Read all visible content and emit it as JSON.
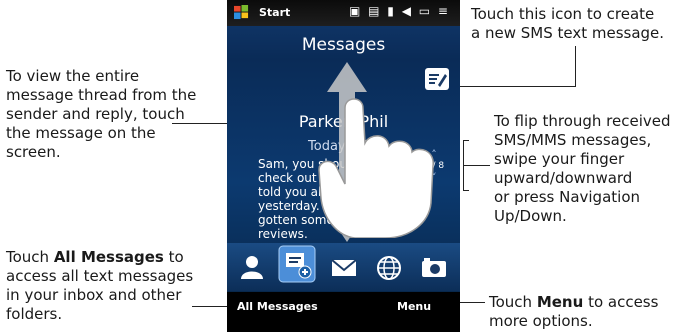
{
  "callouts": {
    "compose": [
      "Touch this icon to create",
      "a new SMS text message."
    ],
    "thread": [
      "To view the entire",
      "message thread from the",
      "sender and reply, touch",
      "the message on the",
      "screen."
    ],
    "flip": [
      "To flip through received",
      "SMS/MMS messages,",
      "swipe your finger",
      "upward/downward",
      "or press Navigation",
      "Up/Down."
    ],
    "allmsg_pre": "Touch ",
    "allmsg_bold": "All Messages",
    "allmsg_post": " to",
    "allmsg_rest": [
      "access all text messages",
      "in your inbox and other",
      "folders."
    ],
    "menu_pre": "Touch ",
    "menu_bold": "Menu",
    "menu_post": " to access",
    "menu_rest": "more options."
  },
  "phone": {
    "status_start": "Start",
    "status_icons": "▣ ▤ ▮ ◀ ▭ ≡",
    "title": "Messages",
    "contact": "Parker, Phil",
    "time": "Today 7:58",
    "message": "Sam, you should\ncheck out the\ntold you about\nyesterday.\ngotten some great\nreviews.",
    "counter": "3 / 8",
    "softkey_left": "All Messages",
    "softkey_right": "Menu"
  },
  "icons": [
    "windows-logo-icon",
    "compose-icon",
    "contact-tab-icon",
    "messages-tab-icon",
    "email-tab-icon",
    "internet-tab-icon",
    "camera-tab-icon"
  ]
}
